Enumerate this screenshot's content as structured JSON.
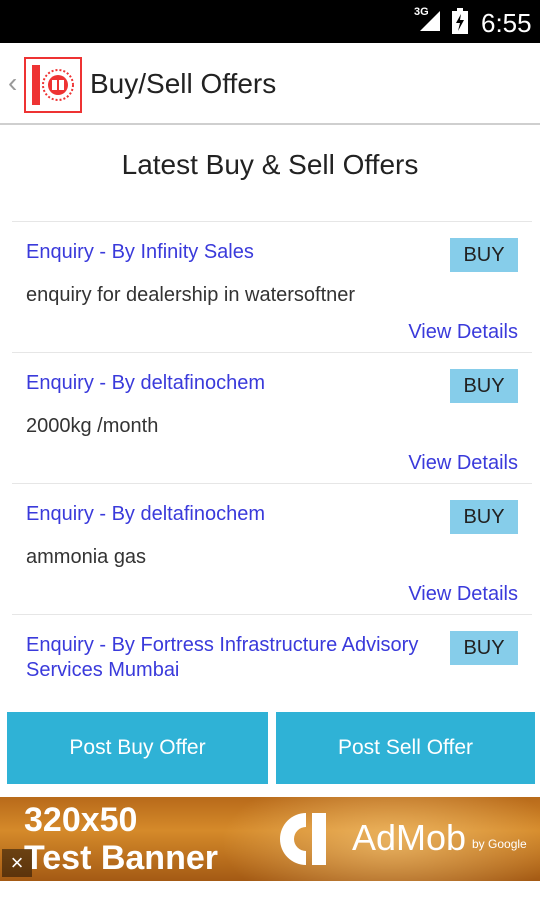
{
  "status_bar": {
    "network": "3G",
    "time": "6:55",
    "signal_icon": "signal-icon",
    "battery_icon": "battery-icon"
  },
  "action_bar": {
    "title": "Buy/Sell Offers",
    "back_icon": "chevron-left-icon",
    "logo": "app-logo"
  },
  "main": {
    "heading": "Latest Buy & Sell Offers",
    "offers": [
      {
        "title": "Enquiry - By Infinity Sales",
        "badge": "BUY",
        "description": "enquiry for dealership in watersoftner",
        "link": "View Details"
      },
      {
        "title": "Enquiry - By deltafinochem",
        "badge": "BUY",
        "description": "2000kg /month",
        "link": "View Details"
      },
      {
        "title": "Enquiry - By deltafinochem",
        "badge": "BUY",
        "description": "ammonia gas",
        "link": "View Details"
      },
      {
        "title": "Enquiry - By Fortress Infrastructure Advisory Services Mumbai",
        "badge": "BUY",
        "description": "",
        "link": ""
      }
    ]
  },
  "buttons": {
    "post_buy": "Post Buy Offer",
    "post_sell": "Post Sell Offer"
  },
  "ad": {
    "line1": "320x50",
    "line2": "Test Banner",
    "brand": "AdMob",
    "brand_sub": "by Google",
    "close": "×"
  },
  "colors": {
    "accent": "#2fb2d6",
    "link": "#3a3adb",
    "badge": "#86cdea"
  }
}
